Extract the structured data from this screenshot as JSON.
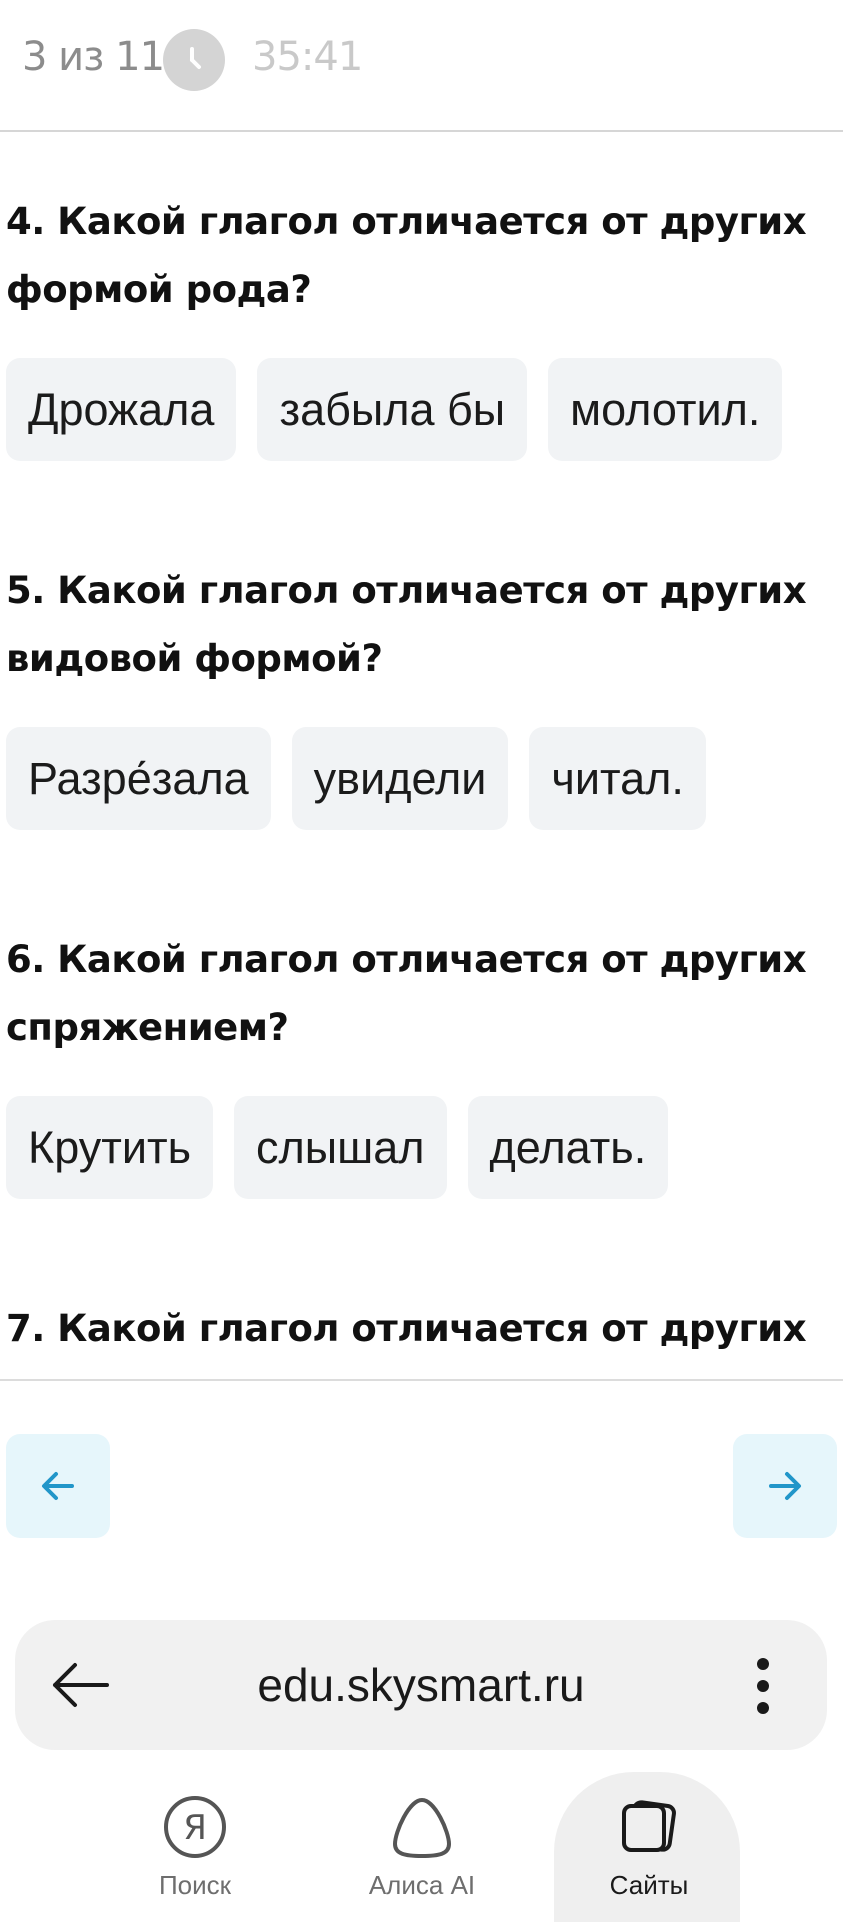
{
  "header": {
    "counter": "3 из 11",
    "timer": "35:41",
    "timer_icon": "clock-icon"
  },
  "questions": [
    {
      "title_line1": "4. Какой глагол отличается от других",
      "title_line2": "формой рода?",
      "options": [
        "Дрожала",
        "забыла бы",
        "молотил."
      ]
    },
    {
      "title_line1": "5. Какой глагол отличается от других",
      "title_line2": "видовой формой?",
      "options": [
        "Разре́зала",
        "увидели",
        "читал."
      ]
    },
    {
      "title_line1": "6. Какой глагол отличается от других",
      "title_line2": "спряжением?",
      "options": [
        "Крутить",
        "слышал",
        "делать."
      ]
    },
    {
      "title_line1": "7. Какой глагол отличается от других"
    }
  ],
  "navigation": {
    "prev_icon": "arrow-left-icon",
    "next_icon": "arrow-right-icon",
    "accent": "#2196c9"
  },
  "browser": {
    "url": "edu.skysmart.ru",
    "back_icon": "back-arrow-icon",
    "menu_icon": "kebab-menu-icon"
  },
  "bottom_nav": {
    "tabs": [
      {
        "label": "Поиск",
        "icon": "yandex-icon"
      },
      {
        "label": "Алиса AI",
        "icon": "alice-icon"
      },
      {
        "label": "Сайты",
        "icon": "tabs-icon",
        "active": true
      }
    ]
  }
}
